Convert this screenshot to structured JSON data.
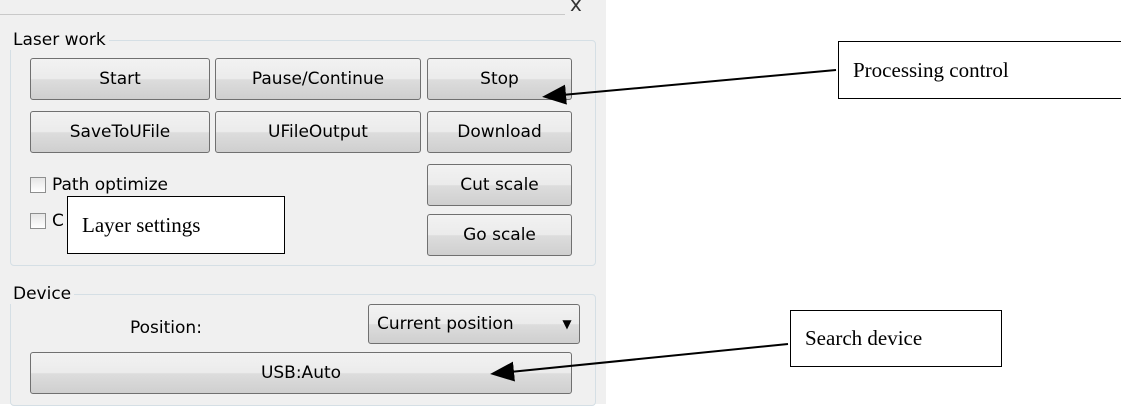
{
  "window": {
    "close_glyph": "x"
  },
  "laser_work": {
    "title": "Laser work",
    "buttons": {
      "start": "Start",
      "pause_continue": "Pause/Continue",
      "stop": "Stop",
      "save_to_ufile": "SaveToUFile",
      "ufile_output": "UFileOutput",
      "download": "Download",
      "cut_scale": "Cut scale",
      "go_scale": "Go scale"
    },
    "checkboxes": {
      "path_optimize": {
        "label": "Path optimize",
        "checked": false
      },
      "second_option": {
        "label": "C",
        "checked": false
      }
    }
  },
  "device": {
    "title": "Device",
    "position_label": "Position:",
    "position_select": {
      "selected": "Current position"
    },
    "usb_button": "USB:Auto"
  },
  "annotations": {
    "processing_control": "Processing control",
    "layer_settings": "Layer settings",
    "search_device": "Search device"
  }
}
